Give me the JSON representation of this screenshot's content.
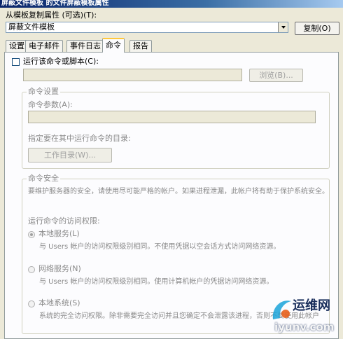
{
  "window": {
    "title": "屏蔽文件模板 的文件屏蔽模板属性"
  },
  "copy_from": {
    "label": "从模板复制属性 (可选)(T):",
    "selected": "屏蔽文件模板",
    "copy_button": "复制(O)"
  },
  "tabs": [
    {
      "label": "设置"
    },
    {
      "label": "电子邮件"
    },
    {
      "label": "事件日志"
    },
    {
      "label": "命令"
    },
    {
      "label": "报告"
    }
  ],
  "command_tab": {
    "run_checkbox_label": "运行该命令或脚本(C):",
    "script_path_value": "",
    "browse_button": "浏览(B)...",
    "settings_group": {
      "legend": "命令设置",
      "args_label": "命令参数(A):",
      "args_value": "",
      "workdir_label": "指定要在其中运行命令的目录:",
      "workdir_button": "工作目录(W)..."
    },
    "security_group": {
      "legend": "命令安全",
      "description": "要维护服务器的安全，请使用尽可能严格的帐户。如果进程泄漏，此帐户将有助于保护系统安全。",
      "access_label": "运行命令的访问权限:",
      "options": [
        {
          "label": "本地服务(L)",
          "desc": "与 Users 帐户的访问权限级别相同。不使用凭据以空会话方式访问网络资源。",
          "selected": true
        },
        {
          "label": "网络服务(N)",
          "desc": "与 Users 帐户的访问权限级别相同。使用计算机帐户的凭据访问网络资源。",
          "selected": false
        },
        {
          "label": "本地系统(S)",
          "desc": "系统的完全访问权限。除非需要完全访问并且您确定不会泄露该进程，否则不要使用此帐户。",
          "selected": false
        }
      ]
    }
  },
  "watermark": {
    "text": "运维网",
    "url": "iyunv.com"
  }
}
